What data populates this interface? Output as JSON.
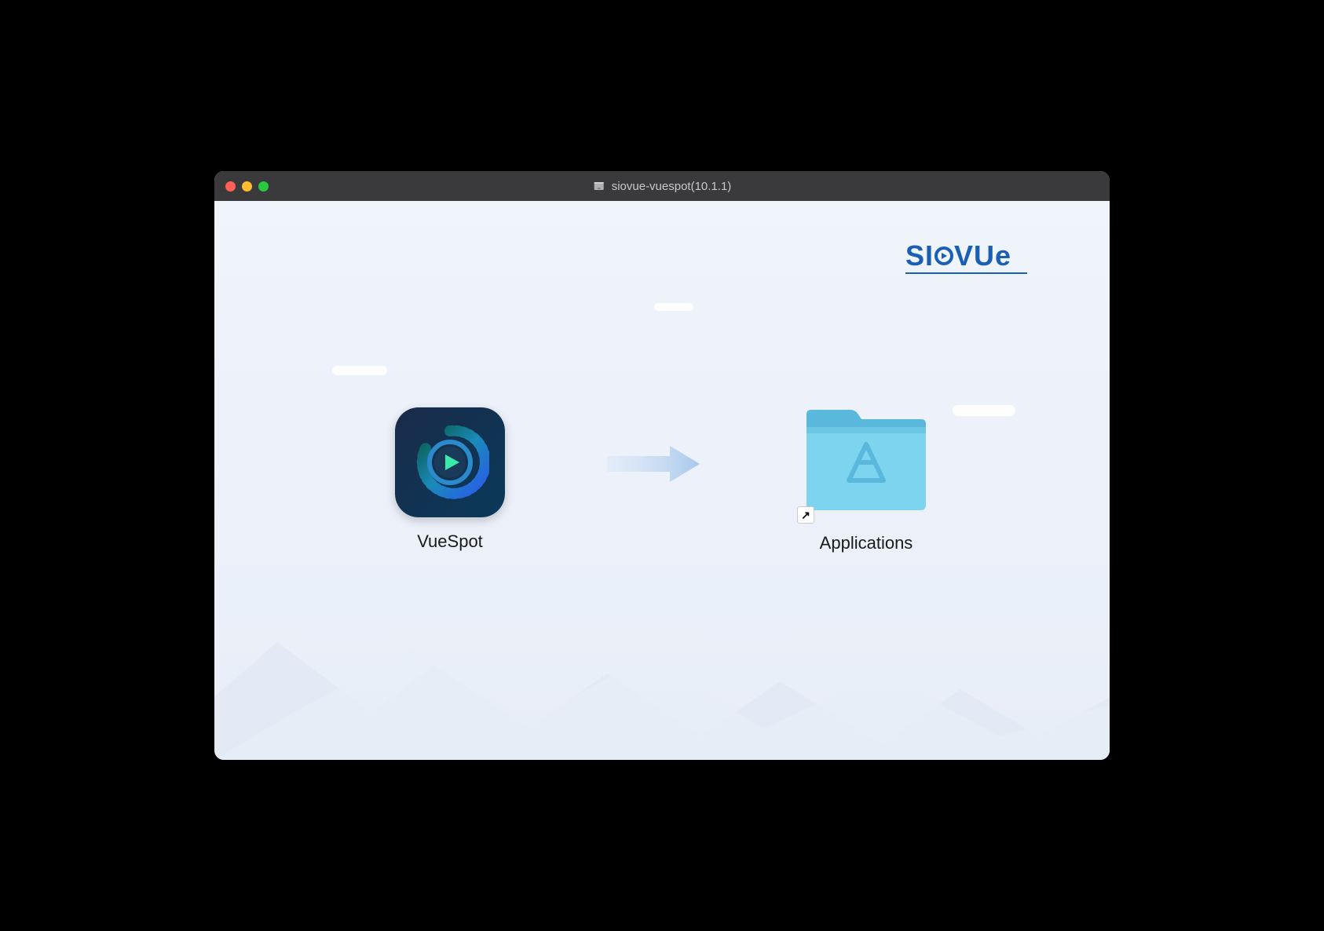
{
  "window": {
    "title": "siovue-vuespot(10.1.1)"
  },
  "brand": {
    "name": "SIOVUE"
  },
  "app": {
    "label": "VueSpot"
  },
  "folder": {
    "label": "Applications"
  }
}
